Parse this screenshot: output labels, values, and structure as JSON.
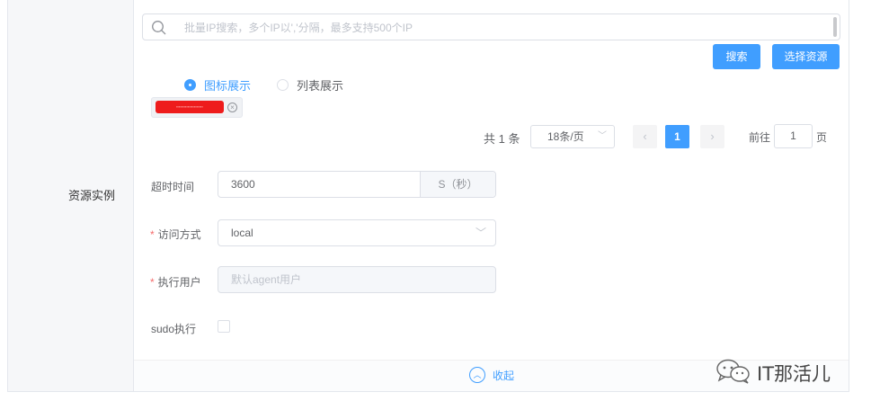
{
  "section": {
    "label": "资源实例"
  },
  "search": {
    "placeholder": "批量IP搜索，多个IP以','分隔，最多支持500个IP",
    "value": ""
  },
  "buttons": {
    "search": "搜索",
    "select_resource": "选择资源"
  },
  "view_mode": {
    "options": [
      "图标展示",
      "列表展示"
    ],
    "selected": "图标展示"
  },
  "tag": {
    "text": "▪▪▪▪▪▪▪▪▪▪▪▪▪▪▪▪▪▪▪▪▪"
  },
  "pagination": {
    "total": "共 1 条",
    "page_size": "18条/页",
    "current_page": "1",
    "goto_label": "前往",
    "goto_value": "1",
    "page_suffix": "页"
  },
  "form": {
    "timeout": {
      "label": "超时时间",
      "value": "3600",
      "unit": "S（秒）"
    },
    "access": {
      "label": "访问方式",
      "value": "local",
      "required_mark": "*"
    },
    "exec_user": {
      "label": "执行用户",
      "placeholder": "默认agent用户",
      "required_mark": "*"
    },
    "sudo": {
      "label": "sudo执行",
      "checked": false
    }
  },
  "collapse": {
    "label": "收起"
  },
  "watermark": {
    "text": "IT那活儿"
  },
  "colors": {
    "primary": "#409eff",
    "required": "#f56c6c",
    "tag_red": "#ee1c1c"
  }
}
